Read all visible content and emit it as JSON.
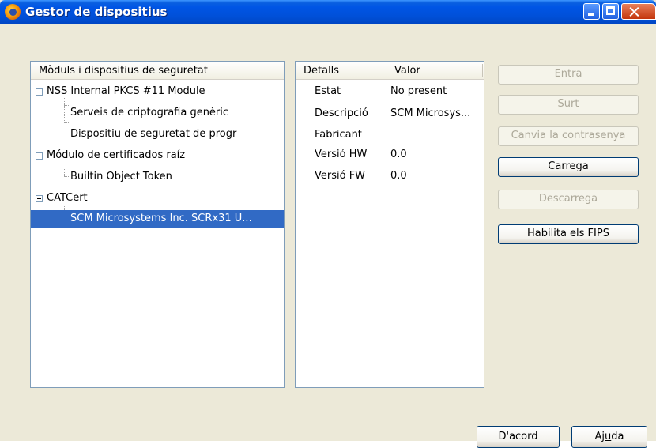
{
  "window": {
    "title": "Gestor de dispositius"
  },
  "tree": {
    "header": "Mòduls i dispositius de seguretat",
    "items": [
      {
        "label": "NSS Internal PKCS #11 Module",
        "level": 0
      },
      {
        "label": "Serveis de criptografia genèric",
        "level": 1
      },
      {
        "label": "Dispositiu de seguretat de progr",
        "level": 1
      },
      {
        "label": "Módulo de certificados raíz",
        "level": 0
      },
      {
        "label": "Builtin Object Token",
        "level": 1
      },
      {
        "label": "CATCert",
        "level": 0
      },
      {
        "label": "SCM Microsystems Inc. SCRx31 U...",
        "level": 1,
        "selected": true
      }
    ]
  },
  "details": {
    "headers": {
      "col1": "Detalls",
      "col2": "Valor"
    },
    "rows": [
      {
        "label": "Estat",
        "value": "No present"
      },
      {
        "label": "Descripció",
        "value": "SCM Microsys..."
      },
      {
        "label": "Fabricant",
        "value": ""
      },
      {
        "label": "Versió HW",
        "value": "0.0"
      },
      {
        "label": "Versió FW",
        "value": "0.0"
      }
    ]
  },
  "buttons": {
    "login": {
      "label": "Entra",
      "enabled": false
    },
    "logout": {
      "label": "Surt",
      "enabled": false
    },
    "change_password": {
      "label": "Canvia la contrasenya",
      "enabled": false
    },
    "load": {
      "label": "Carrega",
      "enabled": true
    },
    "unload": {
      "label": "Descarrega",
      "enabled": false
    },
    "enable_fips": {
      "label": "Habilita els FIPS",
      "enabled": true
    },
    "ok": {
      "label": "D'acord"
    },
    "help": {
      "label_prefix": "Aj",
      "label_access": "u",
      "label_suffix": "da"
    }
  }
}
